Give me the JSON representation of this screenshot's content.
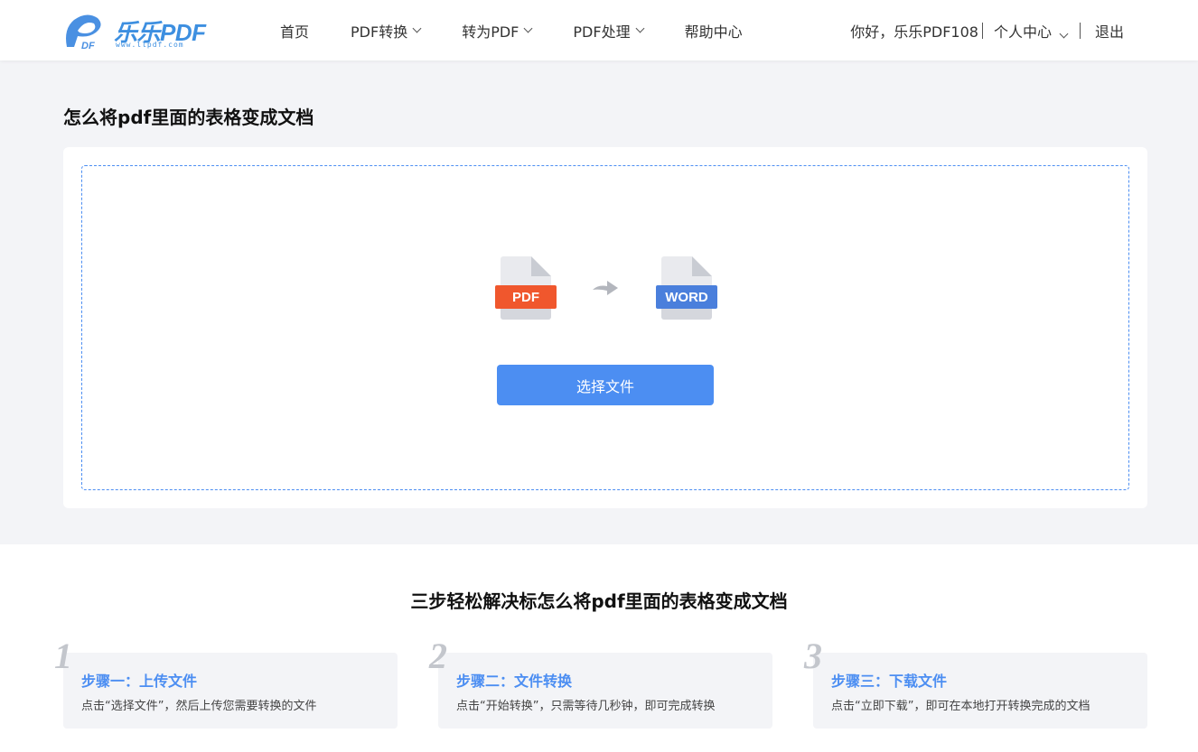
{
  "header": {
    "logo_text": "乐乐PDF",
    "logo_sub": "www.llpdf.com",
    "nav": [
      {
        "label": "首页",
        "dropdown": false
      },
      {
        "label": "PDF转换",
        "dropdown": true
      },
      {
        "label": "转为PDF",
        "dropdown": true
      },
      {
        "label": "PDF处理",
        "dropdown": true
      },
      {
        "label": "帮助中心",
        "dropdown": false
      }
    ],
    "greeting": "你好，乐乐PDF108",
    "user_center": "个人中心",
    "logout": "退出"
  },
  "main": {
    "title": "怎么将pdf里面的表格变成文档",
    "from_label": "PDF",
    "to_label": "WORD",
    "select_button": "选择文件"
  },
  "steps": {
    "title": "三步轻松解决标怎么将pdf里面的表格变成文档",
    "items": [
      {
        "num": "1",
        "title": "步骤一：上传文件",
        "desc": "点击“选择文件”，然后上传您需要转换的文件"
      },
      {
        "num": "2",
        "title": "步骤二：文件转换",
        "desc": "点击“开始转换”，只需等待几秒钟，即可完成转换"
      },
      {
        "num": "3",
        "title": "步骤三：下载文件",
        "desc": "点击“立即下载”，即可在本地打开转换完成的文档"
      }
    ]
  },
  "colors": {
    "accent": "#4c8ef2",
    "pdf": "#f0572d",
    "word": "#4a7fdc"
  }
}
